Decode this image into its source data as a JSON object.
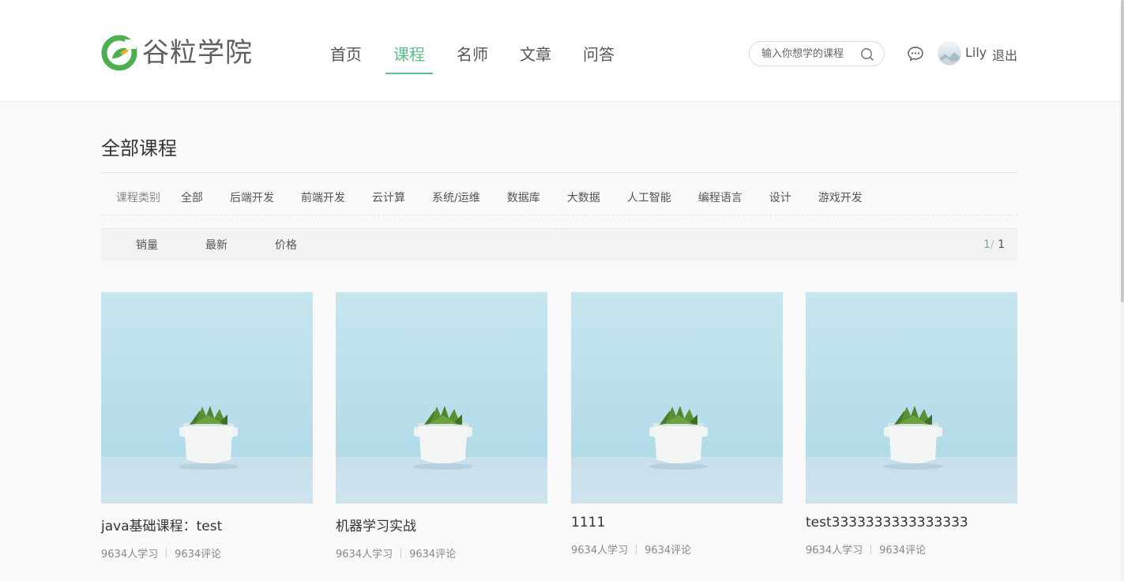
{
  "brand": {
    "name": "谷粒学院",
    "color": "#4caf50",
    "accent": "#f5a623"
  },
  "nav": {
    "items": [
      {
        "label": "首页",
        "active": false
      },
      {
        "label": "课程",
        "active": true
      },
      {
        "label": "名师",
        "active": false
      },
      {
        "label": "文章",
        "active": false
      },
      {
        "label": "问答",
        "active": false
      }
    ],
    "active_color": "#5ebc8d"
  },
  "search": {
    "placeholder": "输入你想学的课程",
    "icon": "search-icon"
  },
  "user": {
    "name": "Lily",
    "logout_label": "退出",
    "message_icon": "message-icon"
  },
  "page": {
    "title": "全部课程"
  },
  "categories": {
    "label": "课程类别",
    "items": [
      "全部",
      "后端开发",
      "前端开发",
      "云计算",
      "系统/运维",
      "数据库",
      "大数据",
      "人工智能",
      "编程语言",
      "设计",
      "游戏开发"
    ]
  },
  "sort": {
    "items": [
      "销量",
      "最新",
      "价格"
    ],
    "pager": {
      "current": "1",
      "separator": "/",
      "total": "1"
    }
  },
  "courses": [
    {
      "title": "java基础课程：test",
      "learners": "9634人学习",
      "comments": "9634评论"
    },
    {
      "title": "机器学习实战",
      "learners": "9634人学习",
      "comments": "9634评论"
    },
    {
      "title": "1111",
      "learners": "9634人学习",
      "comments": "9634评论"
    },
    {
      "title": "test3333333333333333",
      "learners": "9634人学习",
      "comments": "9634评论"
    }
  ]
}
